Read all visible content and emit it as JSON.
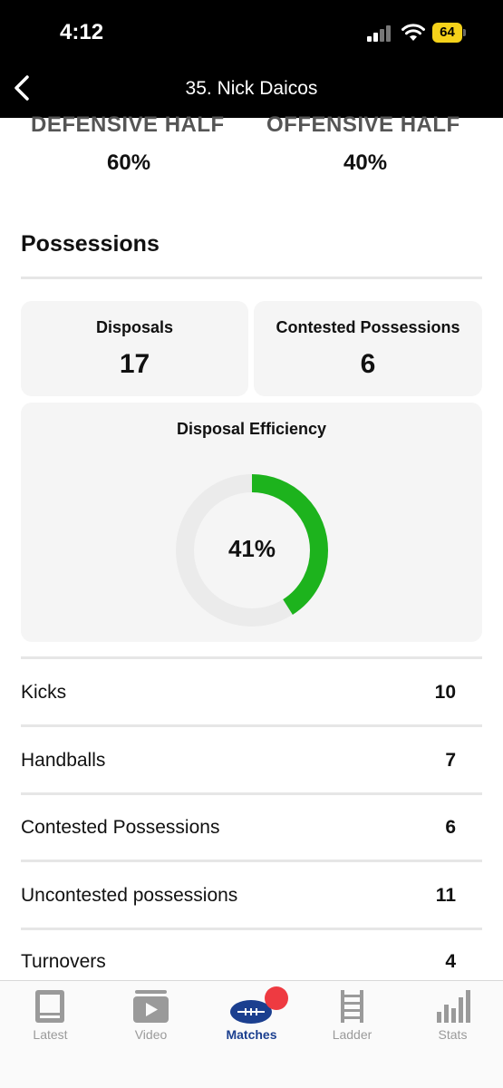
{
  "status_bar": {
    "time": "4:12",
    "battery": "64"
  },
  "header": {
    "title": "35. Nick Daicos"
  },
  "halves": [
    {
      "label": "DEFENSIVE HALF",
      "value": "60%"
    },
    {
      "label": "OFFENSIVE HALF",
      "value": "40%"
    }
  ],
  "possessions": {
    "title": "Possessions",
    "cards": [
      {
        "label": "Disposals",
        "value": "17"
      },
      {
        "label": "Contested Possessions",
        "value": "6"
      }
    ],
    "efficiency": {
      "label": "Disposal Efficiency",
      "value_text": "41%",
      "fraction": 0.41,
      "color": "#1db31d",
      "track_color": "#ebebeb"
    }
  },
  "stats": [
    {
      "label": "Kicks",
      "value": "10"
    },
    {
      "label": "Handballs",
      "value": "7"
    },
    {
      "label": "Contested Possessions",
      "value": "6"
    },
    {
      "label": "Uncontested possessions",
      "value": "11"
    },
    {
      "label": "Turnovers",
      "value": "4"
    }
  ],
  "tabs": [
    {
      "label": "Latest",
      "icon": "latest-icon"
    },
    {
      "label": "Video",
      "icon": "video-icon"
    },
    {
      "label": "Matches",
      "icon": "football-icon",
      "active": true
    },
    {
      "label": "Ladder",
      "icon": "ladder-icon"
    },
    {
      "label": "Stats",
      "icon": "stats-icon"
    }
  ],
  "colors": {
    "accent": "#1b3f8f",
    "badge": "#ee3a41",
    "battery": "#f5d21a"
  }
}
